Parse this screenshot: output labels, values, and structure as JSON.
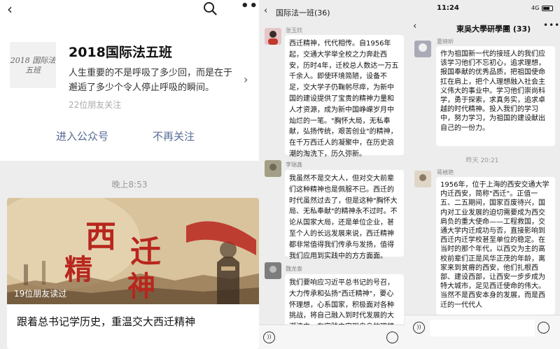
{
  "official": {
    "name": "2018国际法五班",
    "logo_text": "2018 国际法五班",
    "description": "人生重要的不是呼吸了多少回，而是在于邂逅了多少个令人停止呼吸的瞬间。",
    "followers": "22位朋友关注",
    "enter_label": "进入公众号",
    "unfollow_label": "不再关注",
    "message_time": "晚上8:53",
    "article": {
      "cover_text": "西迁精神",
      "read_count": "19位朋友读过",
      "title": "跟着总书记学历史，重温交大西迁精神"
    },
    "icons": [
      "back-icon",
      "search-icon",
      "more-icon",
      "chevron-right-icon"
    ]
  },
  "chat1": {
    "title": "国际法一班(36)",
    "messages": [
      {
        "sender": "张玉欣",
        "text": "西迁精神，代代相传。自1956年起，交通大学举全校之力奔赴西安，历时4年，迁校总人数达一万五千余人。即使环境简陋，设备不足，交大学子仍鞠躬尽瘁，为新中国的建设提供了宝贵的精神力量和人才资源，成为新中国峥嵘岁月中灿烂的一笔。\"胸怀大局，无私奉献，弘扬传统，艰苦创业\"的精神，在千万西迁人的凝聚中，在历史浪潮的淘洗下，历久弥新。"
      },
      {
        "sender": "李瑞鑫",
        "text": "我虽然不是交大人，但对交大前辈们这种精神也是佩服不已。西迁的时代虽然过去了，但是这种\"胸怀大局、无私奉献\"的精神永不过时。不论从国家大局，还是单位企业，甚至个人的长远发展来说，西迁精神都非常值得我们传承与发扬，值得我们应用到实践中的方方面面。"
      },
      {
        "sender": "魏龙泰",
        "text": "我们要响应习近平总书记的号召，大力传承和弘扬\"西迁精神\"，要心怀理想，心系国家，积极面对各种挑战，将自己融入到时代发展的大潮流中，在实践中实现自身的理想"
      }
    ]
  },
  "chat2": {
    "status_time": "11:24",
    "network": "4G",
    "title": "東吳大學研學團 (33)",
    "divider_time": "昨天 20:21",
    "messages": [
      {
        "sender": "夏映昕",
        "text": "作为祖国新一代的接班人的我们应该学习他们不忘初心，追求理想，报国奉献的优秀品质，把祖国使命扛在肩上，把个人理想融入社会主义伟大的事业中。学习他们崇尚科学，勇于探索，求真务实，追求卓越的时代精神。投入我们的学习中，努力学习，为祖国的建设献出自己的一份力。"
      },
      {
        "sender": "蒋楨艳",
        "text": "1956年，位于上海的西安交通大学内迁西安，简称\"西迁\"。正值一五、二五期间，国家百废待兴，国内对工业发展的迫切需要成为西交肩负的重大使命——工程救国，交通大学内迁成功与否，直接影响到西迁内迁学校甚至单位的稳定。在当时的那个年代，以西交为主的高校前辈们正是风华正茂的年龄，离家来到贫瘠的西安，他们扎根西部、建设西部，让西安一步步成为特大城市，足见西迁使命的伟大。当然不是西安本身的发展，而是西迁的一代代人"
      }
    ]
  },
  "colors": {
    "link_blue": "#576b95",
    "chat_bg": "#ededed",
    "banner_red": "#b8261e",
    "bubble_white": "#ffffff"
  }
}
